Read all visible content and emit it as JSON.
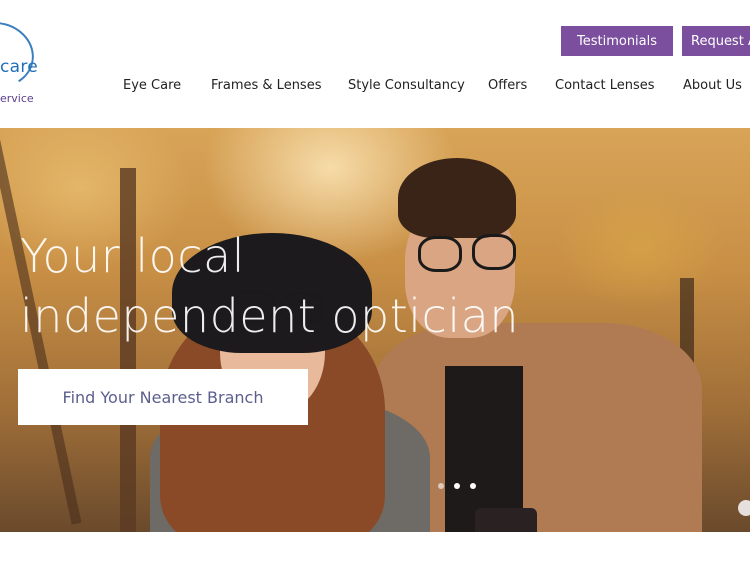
{
  "logo": {
    "line1": "care",
    "line2": "ervice"
  },
  "top_buttons": {
    "testimonials": "Testimonials",
    "request": "Request A"
  },
  "nav": {
    "items": [
      {
        "label": "Eye Care"
      },
      {
        "label": "Frames & Lenses"
      },
      {
        "label": "Style Consultancy"
      },
      {
        "label": "Offers"
      },
      {
        "label": "Contact Lenses"
      },
      {
        "label": "About Us"
      }
    ]
  },
  "hero": {
    "title_line1": "Your local",
    "title_line2": "independent optician",
    "cta": "Find Your Nearest Branch",
    "slides": [
      {
        "active": false
      },
      {
        "active": true
      },
      {
        "active": true
      }
    ]
  },
  "colors": {
    "accent": "#7b4f9e",
    "cta_text": "#5c5f8e"
  }
}
